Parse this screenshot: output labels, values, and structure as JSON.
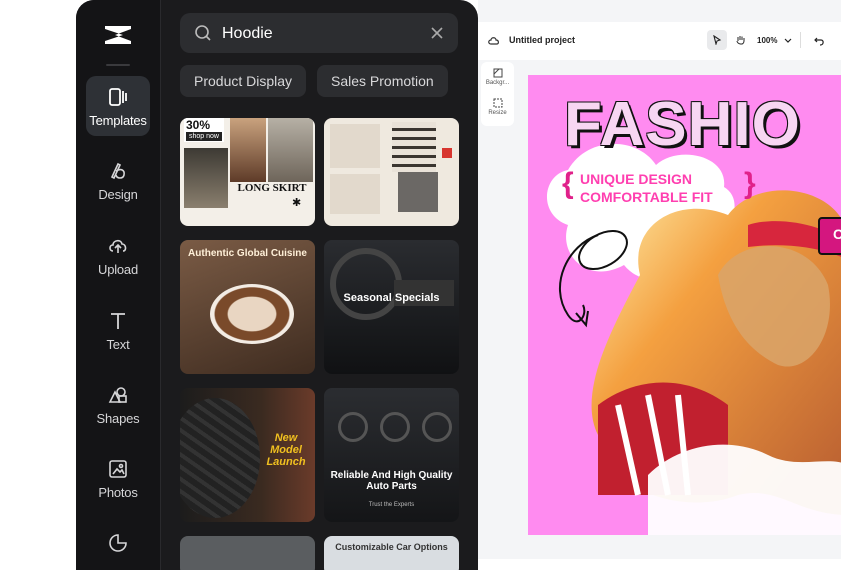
{
  "rail": {
    "items": [
      {
        "label": "Templates",
        "icon": "templates-icon"
      },
      {
        "label": "Design",
        "icon": "design-icon"
      },
      {
        "label": "Upload",
        "icon": "upload-icon"
      },
      {
        "label": "Text",
        "icon": "text-icon"
      },
      {
        "label": "Shapes",
        "icon": "shapes-icon"
      },
      {
        "label": "Photos",
        "icon": "photos-icon"
      }
    ]
  },
  "search": {
    "value": "Hoodie"
  },
  "chips": [
    "Product Display",
    "Sales Promotion"
  ],
  "templates": {
    "t1": {
      "badge": "30%",
      "shop": "shop now",
      "title": "LONG SKIRT"
    },
    "t3": {
      "title": "Authentic Global Cuisine"
    },
    "t4": {
      "title": "Seasonal Specials"
    },
    "t5": {
      "title": "New Model Launch"
    },
    "t6": {
      "title": "Reliable And High Quality Auto Parts",
      "sub": "Trust the Experts"
    },
    "t8": {
      "title": "Customizable Car Options"
    }
  },
  "editor": {
    "project_title": "Untitled project",
    "zoom": "100%",
    "mini_tools": [
      "Backgr...",
      "Resize"
    ]
  },
  "design": {
    "headline": "FASHIO",
    "line1": "UNIQUE DESIGN",
    "line2": "COMFORTABLE FIT",
    "bg_color": "#ff8bf0",
    "accent_color": "#e0218a"
  }
}
